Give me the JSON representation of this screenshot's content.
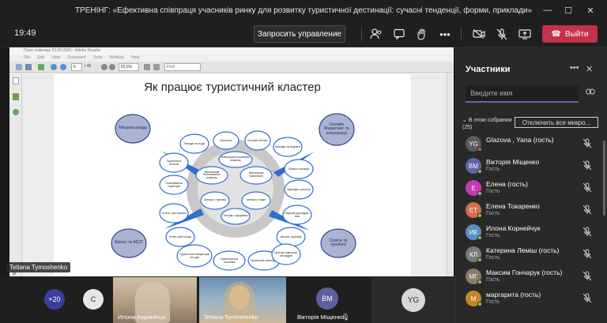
{
  "window": {
    "title": "ТРЕНІНГ: «Ефективна співпраця учасників ринку для розвитку туристичної дестинації: сучасні тенденції, форми, приклади»"
  },
  "toolbar": {
    "time": "19:49",
    "request_control": "Запросить управление",
    "leave": "Выйти"
  },
  "reader": {
    "title": "План семінару 23.09.2020 - Adobe Reader",
    "menu": [
      "File",
      "Edit",
      "View",
      "Document",
      "Tools",
      "Window",
      "Help"
    ],
    "page_current": "6",
    "page_total": "/ 45",
    "zoom": "82,6%",
    "find_placeholder": "Find"
  },
  "slide": {
    "title": "Як працює туристичний кластер",
    "corners": [
      {
        "label": "Місцева влада"
      },
      {
        "label": "Онлайн Маркетинг та комунікації"
      },
      {
        "label": "Бізнес та МСП"
      },
      {
        "label": "Освіта та тренінги"
      }
    ],
    "nodes": [
      {
        "label": "Заходи та події"
      },
      {
        "label": "Екологія"
      },
      {
        "label": "Онлайн бізнес"
      },
      {
        "label": "Бренди та ініціати"
      },
      {
        "label": "Туристичні об'єкти"
      },
      {
        "label": "Гастро-локація"
      },
      {
        "label": "Планування території"
      },
      {
        "label": "Брендінг регіону"
      },
      {
        "label": "Готелі, ресторани"
      },
      {
        "label": "Наукові дослідже-ння"
      },
      {
        "label": "Інтел-агентства"
      },
      {
        "label": "Школи туризму"
      },
      {
        "label": "Туристичні оператори та гіди"
      },
      {
        "label": "Транспортна система"
      },
      {
        "label": "Тренінгові семінари"
      },
      {
        "label": "Центри підготов-ки кадрів"
      }
    ],
    "center": [
      {
        "label": "Міжгалузеві економічні розвитку"
      },
      {
        "label": "Міжгалузеві Регіонального розвитку"
      },
      {
        "label": "Міжгалузеві транспорту"
      },
      {
        "label": "Агенція з туризму"
      },
      {
        "label": "Агенція із подія"
      },
      {
        "label": "Агенція з підтримки"
      }
    ]
  },
  "presenter_tag": "Tetiana Tymoshenko",
  "panel": {
    "title": "Участники",
    "search_placeholder": "Введите имя",
    "in_meeting": "В этом собрании (25)",
    "mute_all": "Отключить все микро...",
    "participants": [
      {
        "initials": "YG",
        "name": "Glazova , Yana (гость)",
        "role": "",
        "color": "#5b5b5b",
        "dot": "#e05656"
      },
      {
        "initials": "ВМ",
        "name": "Вікторія Міщенко",
        "role": "Гость",
        "color": "#6264a7",
        "dot": "#92c353"
      },
      {
        "initials": "Е",
        "name": "Елена (гость)",
        "role": "Гость",
        "color": "#c239b3",
        "dot": "#92c353"
      },
      {
        "initials": "ЕТ",
        "name": "Елена Токаренко",
        "role": "Гость",
        "color": "#d06e4f",
        "dot": "#92c353"
      },
      {
        "initials": "ИК",
        "name": "Илона Корнейчук",
        "role": "Гость",
        "color": "#5a8fc4",
        "dot": "#92c353"
      },
      {
        "initials": "КЛ",
        "name": "Катерина Леміш (гость)",
        "role": "Гость",
        "color": "#7a7a7a",
        "dot": "#92c353"
      },
      {
        "initials": "МГ",
        "name": "Максим Гончарук (гость)",
        "role": "Гость",
        "color": "#8c7a6b",
        "dot": "#92c353"
      },
      {
        "initials": "М",
        "name": "маргарита (гость)",
        "role": "Гость",
        "color": "#c4842a",
        "dot": "#92c353"
      }
    ]
  },
  "strip": {
    "more_count": "+20",
    "bubble_c": "C",
    "tile1_name": "Илона Корнейчук",
    "tile2_name": "Tetiana Tymoshenko",
    "bubble_vm": "ВМ",
    "tile3_name": "Вікторія Міщенко",
    "bubble_yg": "YG"
  }
}
